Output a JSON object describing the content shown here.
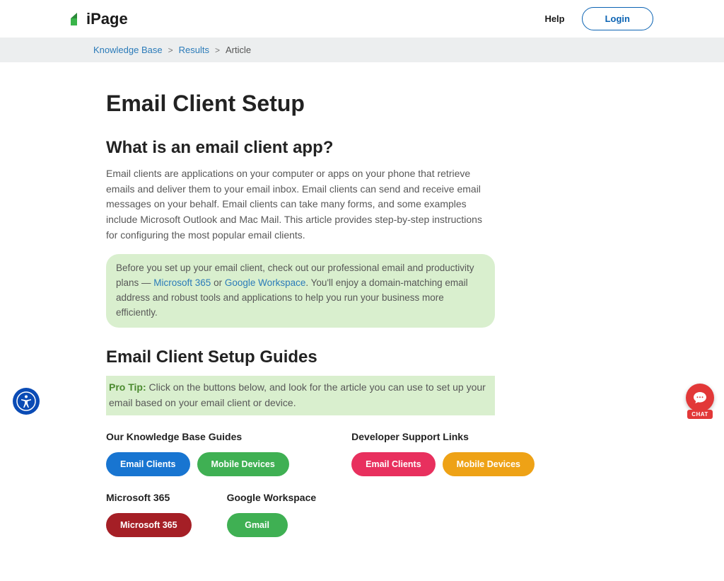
{
  "header": {
    "logo_text": "iPage",
    "help_label": "Help",
    "login_label": "Login"
  },
  "breadcrumb": {
    "items": [
      {
        "label": "Knowledge Base",
        "link": true
      },
      {
        "label": "Results",
        "link": true
      },
      {
        "label": "Article",
        "link": false
      }
    ],
    "sep": ">"
  },
  "article": {
    "title": "Email Client Setup",
    "section1_heading": "What is an email client app?",
    "section1_body": "Email clients are applications on your computer or apps on your phone that retrieve emails and deliver them to your email inbox. Email clients can send and receive email messages on your behalf. Email clients can take many forms, and some examples include Microsoft Outlook and Mac Mail. This article provides step-by-step instructions for configuring the most popular email clients.",
    "callout": {
      "pre": "Before you set up your email client, check out our professional email and productivity plans — ",
      "link1": "Microsoft 365",
      "mid": " or ",
      "link2": "Google Workspace",
      "post": ". You'll enjoy a domain-matching email address and robust tools and applications to help you run your business more efficiently."
    },
    "section2_heading": "Email Client Setup Guides",
    "protip": {
      "label": "Pro Tip:",
      "body": " Click on the buttons below, and look for the article you can use to set up your email based on your email client or device."
    },
    "guides": {
      "col1": {
        "row1_heading": "Our Knowledge Base Guides",
        "row1_buttons": [
          {
            "label": "Email Clients",
            "color": "#1875d1"
          },
          {
            "label": "Mobile Devices",
            "color": "#3fb053"
          }
        ],
        "row2_left_heading": "Microsoft 365",
        "row2_left_button": {
          "label": "Microsoft 365",
          "color": "#a51f26"
        },
        "row2_right_heading": "Google Workspace",
        "row2_right_button": {
          "label": "Gmail",
          "color": "#3fb053"
        }
      },
      "col2": {
        "heading": "Developer Support Links",
        "buttons": [
          {
            "label": "Email Clients",
            "color": "#e8305e"
          },
          {
            "label": "Mobile Devices",
            "color": "#eea216"
          }
        ]
      }
    }
  },
  "chat": {
    "label": "CHAT"
  }
}
